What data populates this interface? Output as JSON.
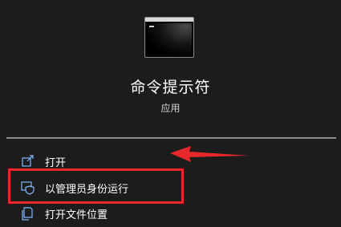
{
  "app": {
    "name": "命令提示符",
    "type_label": "应用",
    "icon": "command-prompt-icon"
  },
  "actions": [
    {
      "label": "打开",
      "icon": "open-icon"
    },
    {
      "label": "以管理员身份运行",
      "icon": "shield-admin-icon"
    },
    {
      "label": "打开文件位置",
      "icon": "file-location-icon"
    }
  ],
  "annotation": {
    "highlight_color": "#e8272a",
    "arrow_color": "#e8272a"
  },
  "colors": {
    "background": "#1c1c1c",
    "icon_accent": "#7fb8ff"
  }
}
